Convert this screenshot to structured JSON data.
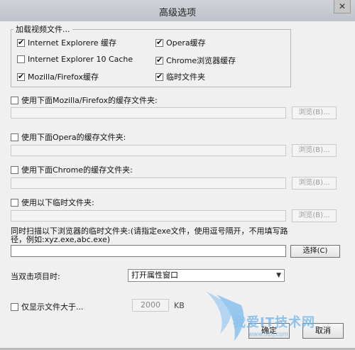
{
  "window": {
    "title": "高级选项",
    "close_glyph": "✕"
  },
  "video_group": {
    "legend": "加载视频文件...",
    "options": [
      {
        "label": "Internet Explorere 缓存",
        "checked": true
      },
      {
        "label": "Opera缓存",
        "checked": true
      },
      {
        "label": "Internet Explorer 10 Cache",
        "checked": false
      },
      {
        "label": "Chrome浏览器缓存",
        "checked": true
      },
      {
        "label": "Mozilla/Firefox缓存",
        "checked": true
      },
      {
        "label": "临时文件夹",
        "checked": true
      }
    ]
  },
  "folders": {
    "browse_label": "浏览(B)...",
    "firefox_label": "使用下面Mozilla/Firefox的缓存文件夹:",
    "opera_label": "使用下面Opera的缓存文件夹:",
    "chrome_label": "使用下面Chrome的缓存文件夹:",
    "temp_label": "使用以下临时文件夹:"
  },
  "scan": {
    "instruction": "同时扫描以下浏览器的临时文件夹:(请指定exe文件，使用逗号隔开，不用填写路径，例如:xyz.exe,abc.exe)",
    "value": "",
    "select_label": "选择(C)"
  },
  "double_click": {
    "label": "当双击项目时:",
    "selected": "打开属性窗口"
  },
  "size_filter": {
    "label": "仅显示文件大于...",
    "value": "2000",
    "unit": "KB"
  },
  "buttons": {
    "ok": "确定",
    "cancel": "取消"
  },
  "watermark": {
    "text": "我爱IT技术网",
    "sub": "www.52ij.com"
  }
}
